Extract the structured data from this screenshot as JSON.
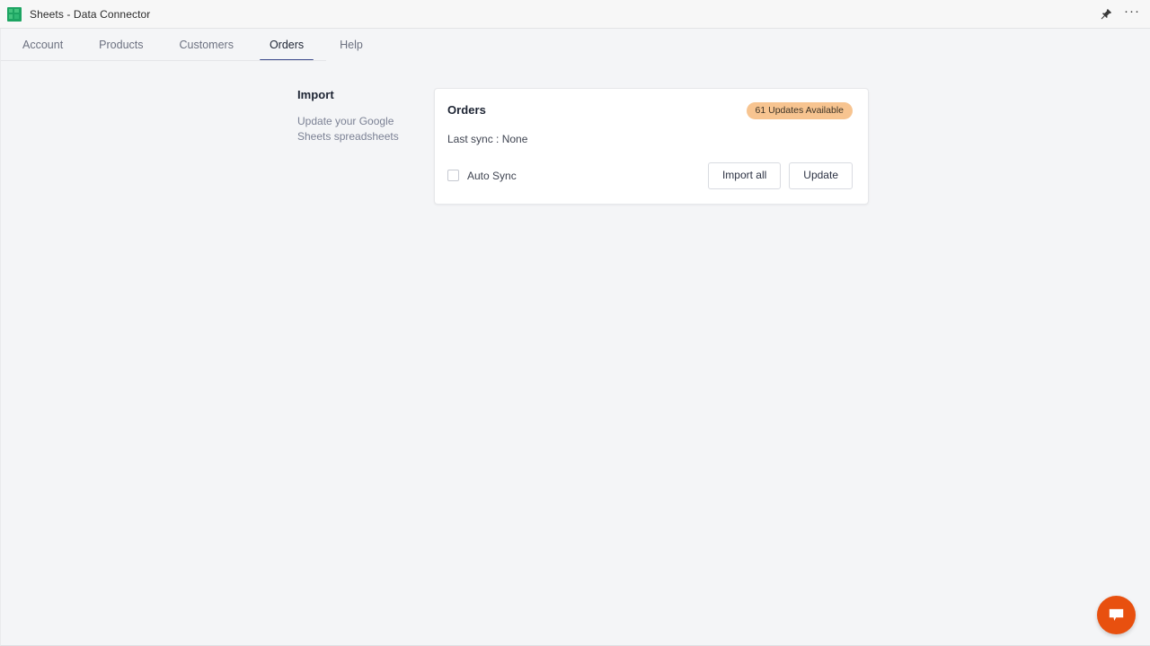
{
  "window": {
    "title": "Sheets - Data Connector",
    "app_icon": "sheets-icon",
    "controls": [
      {
        "name": "pin-icon",
        "label": "Pin"
      },
      {
        "name": "more-options-icon",
        "label": "···"
      }
    ]
  },
  "tabs": [
    {
      "label": "Account",
      "active": false
    },
    {
      "label": "Products",
      "active": false
    },
    {
      "label": "Customers",
      "active": false
    },
    {
      "label": "Orders",
      "active": true
    },
    {
      "label": "Help",
      "active": false
    }
  ],
  "section": {
    "title": "Import",
    "description": "Update your Google Sheets spreadsheets"
  },
  "card": {
    "title": "Orders",
    "badge": "61 Updates Available",
    "last_sync": "Last sync : None",
    "auto_sync_label": "Auto Sync",
    "auto_sync_checked": false,
    "buttons": [
      {
        "label": "Import all"
      },
      {
        "label": "Update"
      }
    ]
  },
  "chat": {
    "icon": "chat-bubble-icon",
    "color": "#e8500f"
  },
  "colors": {
    "accent": "#3c4a8c",
    "badge_bg": "#f7c490",
    "badge_text": "#3d3325",
    "page_bg": "#f4f5f7",
    "titlebar_bg": "#f7f7f7",
    "card_bg": "#ffffff",
    "chat_fab": "#e8500f",
    "sheets_green": "#1da462"
  }
}
